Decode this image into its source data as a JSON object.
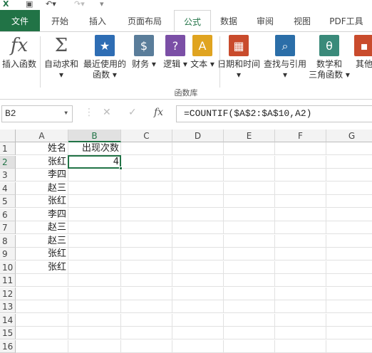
{
  "titlebar": {
    "save_icon": "save-icon",
    "undo_icon": "undo-icon",
    "redo_icon": "redo-icon"
  },
  "tabs": [
    "文件",
    "开始",
    "插入",
    "页面布局",
    "公式",
    "数据",
    "审阅",
    "视图",
    "PDF工具"
  ],
  "ribbon": {
    "buttons": [
      {
        "label": "插入函数",
        "sub": "",
        "glyph": "fx",
        "color": "#555555"
      },
      {
        "label": "自动求和",
        "sub": "",
        "glyph": "Σ",
        "color": "#555555",
        "dropdown": true
      },
      {
        "label": "最近使用的",
        "sub": "函数",
        "glyph": "★",
        "color": "#2e6db4",
        "dropdown": true
      },
      {
        "label": "财务",
        "sub": "",
        "glyph": "$",
        "color": "#5a7d9a",
        "dropdown": true
      },
      {
        "label": "逻辑",
        "sub": "",
        "glyph": "?",
        "color": "#7b4fa6",
        "dropdown": true
      },
      {
        "label": "文本",
        "sub": "",
        "glyph": "A",
        "color": "#e0a420",
        "dropdown": true
      },
      {
        "label": "日期和时间",
        "sub": "",
        "glyph": "▦",
        "color": "#c94b2c",
        "dropdown": true
      },
      {
        "label": "查找与引用",
        "sub": "",
        "glyph": "⌕",
        "color": "#2b6ea8",
        "dropdown": true
      },
      {
        "label": "数学和",
        "sub": "三角函数",
        "glyph": "θ",
        "color": "#3a8a7a",
        "dropdown": true
      },
      {
        "label": "其他",
        "sub": "",
        "glyph": "▪",
        "color": "#c94b2c"
      }
    ],
    "group_label": "函数库"
  },
  "formula_bar": {
    "name_box": "B2",
    "cancel": "✕",
    "confirm": "✓",
    "fx": "fx",
    "formula": "=COUNTIF($A$2:$A$10,A2)"
  },
  "sheet": {
    "columns": [
      "A",
      "B",
      "C",
      "D",
      "E",
      "F",
      "G"
    ],
    "selected_column": "B",
    "selected_row": "2",
    "rows": [
      "1",
      "2",
      "3",
      "4",
      "5",
      "6",
      "7",
      "8",
      "9",
      "10",
      "11",
      "12",
      "13",
      "14",
      "15",
      "16"
    ],
    "cells": {
      "A1": "姓名",
      "B1": "出现次数",
      "A2": "张红",
      "B2": "4",
      "A3": "李四",
      "A4": "赵三",
      "A5": "张红",
      "A6": "李四",
      "A7": "赵三",
      "A8": "赵三",
      "A9": "张红",
      "A10": "张红"
    }
  }
}
